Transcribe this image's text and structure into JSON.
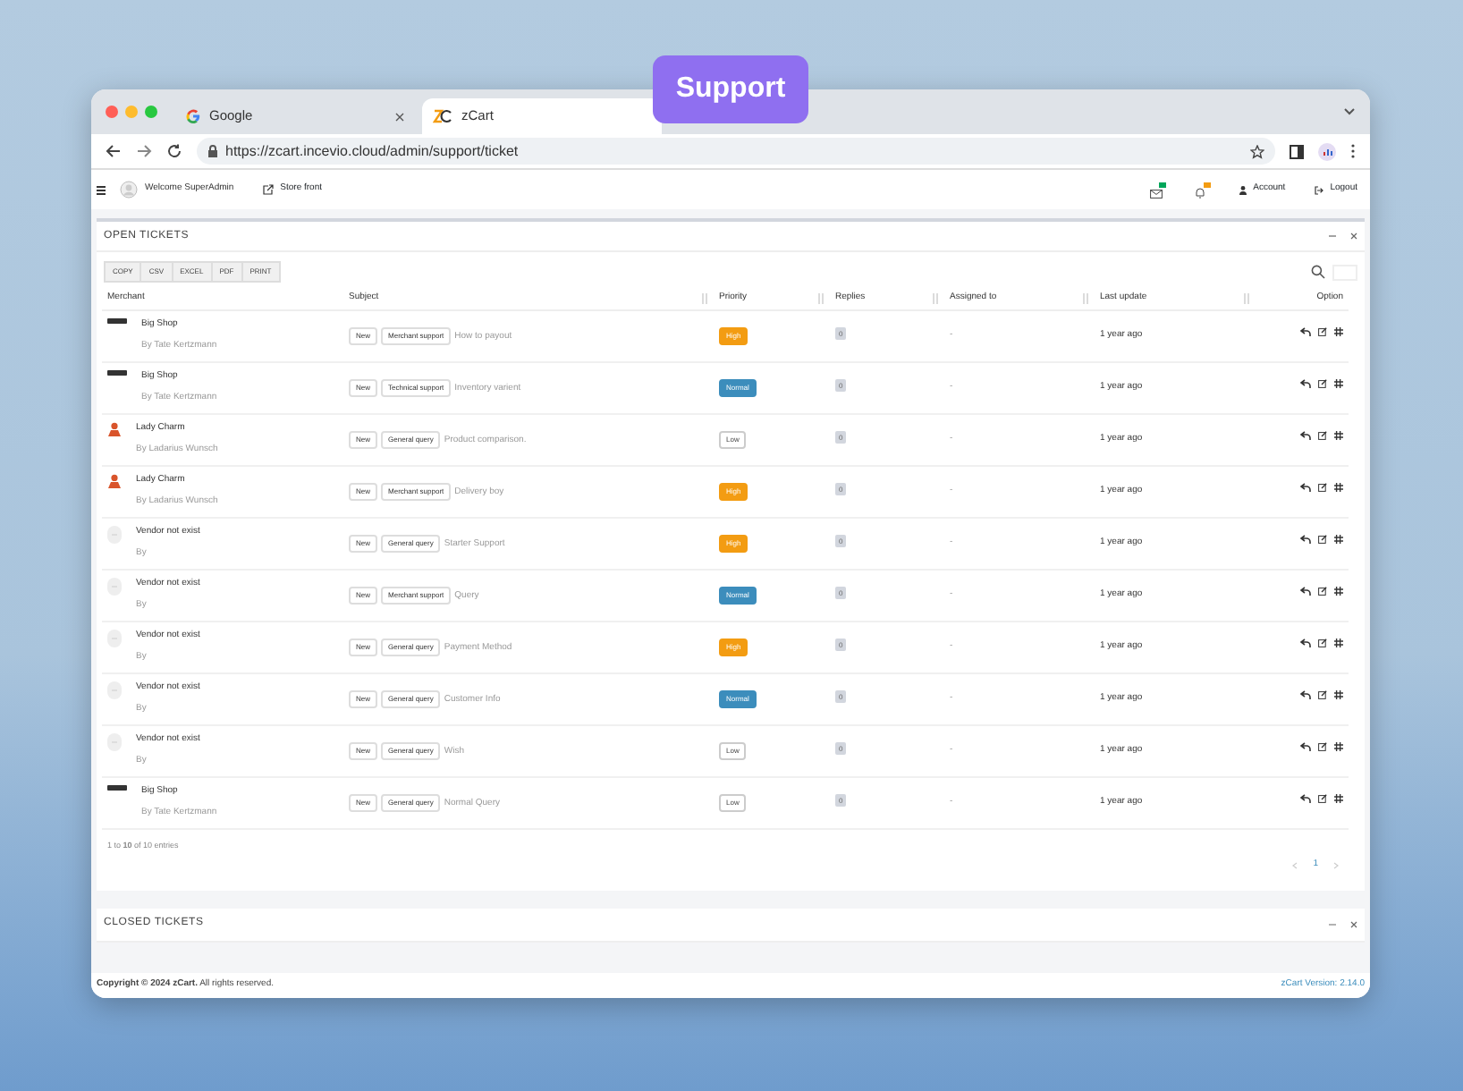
{
  "badge": "Support",
  "browser": {
    "tabs": [
      {
        "title": "Google",
        "selected": false
      },
      {
        "title": "zCart",
        "selected": true
      }
    ],
    "url": "https://zcart.incevio.cloud/admin/support/ticket"
  },
  "header": {
    "welcome": "Welcome SuperAdmin",
    "storefront": "Store front",
    "account": "Account",
    "logout": "Logout"
  },
  "open_tickets": {
    "title": "OPEN TICKETS",
    "export_buttons": [
      "COPY",
      "CSV",
      "EXCEL",
      "PDF",
      "PRINT"
    ],
    "columns": [
      {
        "label": "Merchant",
        "sortable": false
      },
      {
        "label": "Subject",
        "sortable": true
      },
      {
        "label": "Priority",
        "sortable": true
      },
      {
        "label": "Replies",
        "sortable": true
      },
      {
        "label": "Assigned to",
        "sortable": true
      },
      {
        "label": "Last update",
        "sortable": true
      },
      {
        "label": "Option",
        "sortable": false
      }
    ],
    "rows": [
      {
        "kind": "text",
        "merchant": "Big Shop",
        "owner": "By Tate Kertzmann",
        "tags": [
          "New",
          "Merchant support"
        ],
        "subject": "How to payout",
        "priority": {
          "label": "High",
          "kind": "high"
        },
        "replies": "0",
        "assigned": "-",
        "last_update": "1 year ago"
      },
      {
        "kind": "text",
        "merchant": "Big Shop",
        "owner": "By Tate Kertzmann",
        "tags": [
          "New",
          "Technical support"
        ],
        "subject": "Inventory varient",
        "priority": {
          "label": "Normal",
          "kind": "normal"
        },
        "replies": "0",
        "assigned": "-",
        "last_update": "1 year ago"
      },
      {
        "kind": "person",
        "merchant": "Lady Charm",
        "owner": "By Ladarius Wunsch",
        "tags": [
          "New",
          "General query"
        ],
        "subject": "Product comparison.",
        "priority": {
          "label": "Low",
          "kind": "low"
        },
        "replies": "0",
        "assigned": "-",
        "last_update": "1 year ago"
      },
      {
        "kind": "person",
        "merchant": "Lady Charm",
        "owner": "By Ladarius Wunsch",
        "tags": [
          "New",
          "Merchant support"
        ],
        "subject": "Delivery boy",
        "priority": {
          "label": "High",
          "kind": "high"
        },
        "replies": "0",
        "assigned": "-",
        "last_update": "1 year ago"
      },
      {
        "kind": "blank",
        "merchant": "Vendor not exist",
        "owner": "By",
        "tags": [
          "New",
          "General query"
        ],
        "subject": "Starter Support",
        "priority": {
          "label": "High",
          "kind": "high"
        },
        "replies": "0",
        "assigned": "-",
        "last_update": "1 year ago"
      },
      {
        "kind": "blank",
        "merchant": "Vendor not exist",
        "owner": "By",
        "tags": [
          "New",
          "Merchant support"
        ],
        "subject": "Query",
        "priority": {
          "label": "Normal",
          "kind": "normal"
        },
        "replies": "0",
        "assigned": "-",
        "last_update": "1 year ago"
      },
      {
        "kind": "blank",
        "merchant": "Vendor not exist",
        "owner": "By",
        "tags": [
          "New",
          "General query"
        ],
        "subject": "Payment Method",
        "priority": {
          "label": "High",
          "kind": "high"
        },
        "replies": "0",
        "assigned": "-",
        "last_update": "1 year ago"
      },
      {
        "kind": "blank",
        "merchant": "Vendor not exist",
        "owner": "By",
        "tags": [
          "New",
          "General query"
        ],
        "subject": "Customer Info",
        "priority": {
          "label": "Normal",
          "kind": "normal"
        },
        "replies": "0",
        "assigned": "-",
        "last_update": "1 year ago"
      },
      {
        "kind": "blank",
        "merchant": "Vendor not exist",
        "owner": "By",
        "tags": [
          "New",
          "General query"
        ],
        "subject": "Wish",
        "priority": {
          "label": "Low",
          "kind": "low"
        },
        "replies": "0",
        "assigned": "-",
        "last_update": "1 year ago"
      },
      {
        "kind": "text",
        "merchant": "Big Shop",
        "owner": "By Tate Kertzmann",
        "tags": [
          "New",
          "General query"
        ],
        "subject": "Normal Query",
        "priority": {
          "label": "Low",
          "kind": "low"
        },
        "replies": "0",
        "assigned": "-",
        "last_update": "1 year ago"
      }
    ],
    "info": "1 to **10** of 10 entries",
    "page": "1"
  },
  "closed_tickets": {
    "title": "CLOSED TICKETS"
  },
  "footer": {
    "copyright": "**Copyright © 2024 zCart.** All rights reserved.",
    "version": "zCart Version: 2.14.0"
  }
}
